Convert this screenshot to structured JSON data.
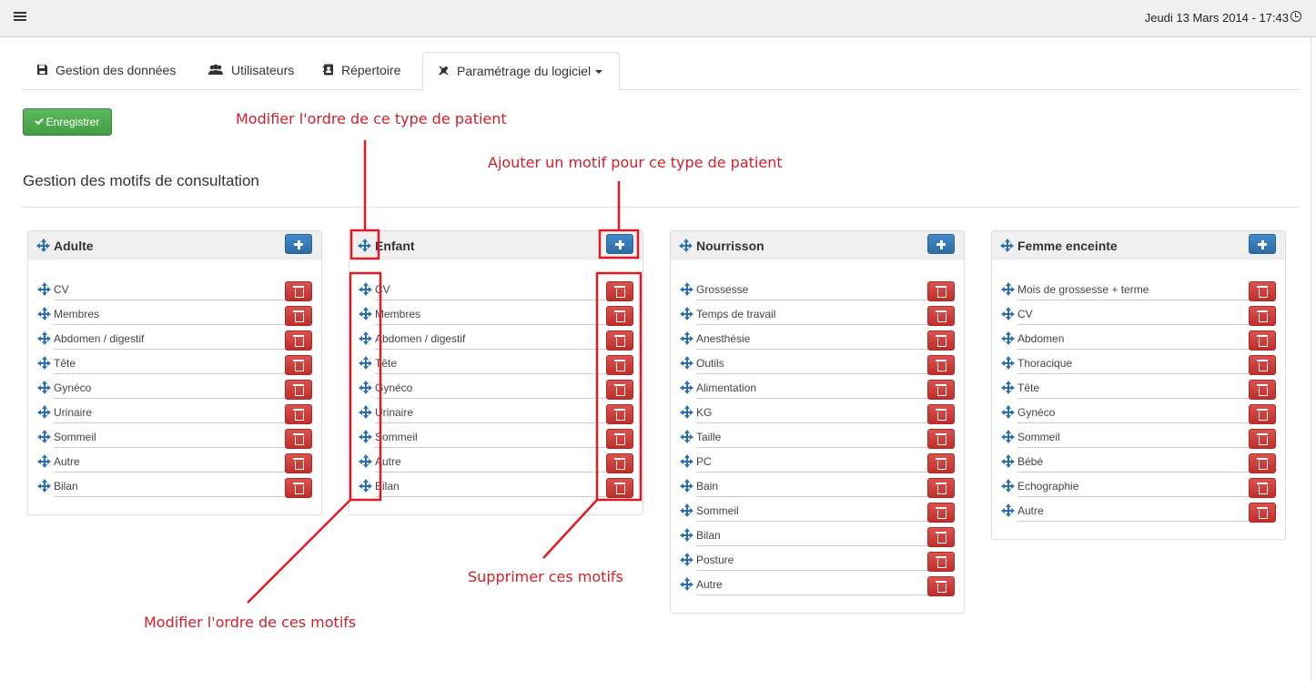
{
  "topbar": {
    "datetime": "Jeudi 13 Mars 2014 - 17:43"
  },
  "tabs": [
    {
      "label": "Gestion des données",
      "icon": "floppy-disk-icon"
    },
    {
      "label": "Utilisateurs",
      "icon": "users-icon"
    },
    {
      "label": "Répertoire",
      "icon": "address-book-icon"
    },
    {
      "label": "Paramétrage du logiciel",
      "icon": "wrench-icon",
      "active": true
    }
  ],
  "save_label": "Enregistrer",
  "section_title": "Gestion des motifs de consultation",
  "colors": {
    "primary": "#428bca",
    "success": "#5cb85c",
    "danger": "#d9534f",
    "annotation": "#d0202a"
  },
  "panels": [
    {
      "title": "Adulte",
      "items": [
        "CV",
        "Membres",
        "Abdomen / digestif",
        "Tête",
        "Gynéco",
        "Urinaire",
        "Sommeil",
        "Autre",
        "Bilan"
      ]
    },
    {
      "title": "Enfant",
      "items": [
        "CV",
        "Membres",
        "Abdomen / digestif",
        "Tête",
        "Gynéco",
        "Urinaire",
        "Sommeil",
        "Autre",
        "Bilan"
      ]
    },
    {
      "title": "Nourrisson",
      "items": [
        "Grossesse",
        "Temps de travail",
        "Anesthésie",
        "Outils",
        "Alimentation",
        "KG",
        "Taille",
        "PC",
        "Bain",
        "Sommeil",
        "Bilan",
        "Posture",
        "Autre"
      ]
    },
    {
      "title": "Femme enceinte",
      "items": [
        "Mois de grossesse + terme",
        "CV",
        "Abdomen",
        "Thoracique",
        "Tête",
        "Gynéco",
        "Sommeil",
        "Bébé",
        "Echographie",
        "Autre"
      ]
    }
  ],
  "annotations": {
    "reorder_type": "Modifier l'ordre de ce type de patient",
    "add_motif": "Ajouter un motif pour ce type de patient",
    "delete_motifs": "Supprimer ces motifs",
    "reorder_motifs": "Modifier l'ordre de ces motifs"
  }
}
